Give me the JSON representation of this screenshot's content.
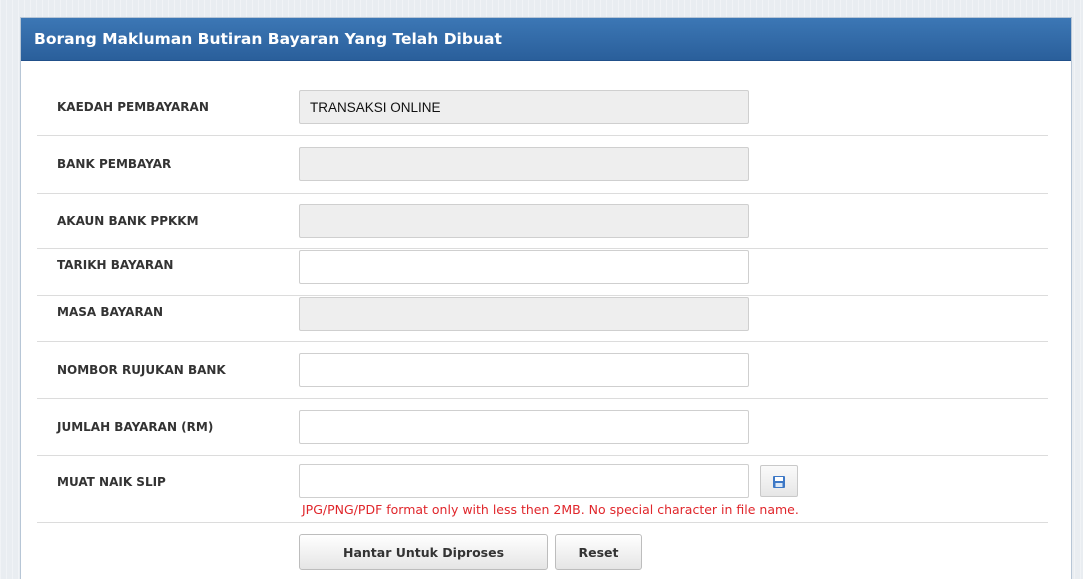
{
  "form": {
    "title": "Borang Makluman Butiran Bayaran Yang Telah Dibuat",
    "fields": {
      "kaedah_pembayaran": {
        "label": "KAEDAH PEMBAYARAN",
        "value": "TRANSAKSI ONLINE"
      },
      "bank_pembayar": {
        "label": "BANK PEMBAYAR",
        "value": ""
      },
      "akaun_bank": {
        "label": "AKAUN BANK PPKKM",
        "value": ""
      },
      "tarikh_bayaran": {
        "label": "TARIKH BAYARAN",
        "value": ""
      },
      "masa_bayaran": {
        "label": "MASA BAYARAN",
        "value": ""
      },
      "nombor_rujukan": {
        "label": "NOMBOR RUJUKAN BANK",
        "value": ""
      },
      "jumlah_bayaran": {
        "label": "JUMLAH BAYARAN (RM)",
        "value": ""
      },
      "muat_naik_slip": {
        "label": "MUAT NAIK SLIP",
        "value": "",
        "icon": "save-icon",
        "hint": "JPG/PNG/PDF format only with less then 2MB. No special character in file name."
      }
    },
    "buttons": {
      "submit_label": "Hantar Untuk Diproses",
      "reset_label": "Reset"
    }
  },
  "colors": {
    "header_bg": "#2f69a8",
    "hint_text": "#e0262b",
    "disabled_field_bg": "#eeeeee"
  }
}
